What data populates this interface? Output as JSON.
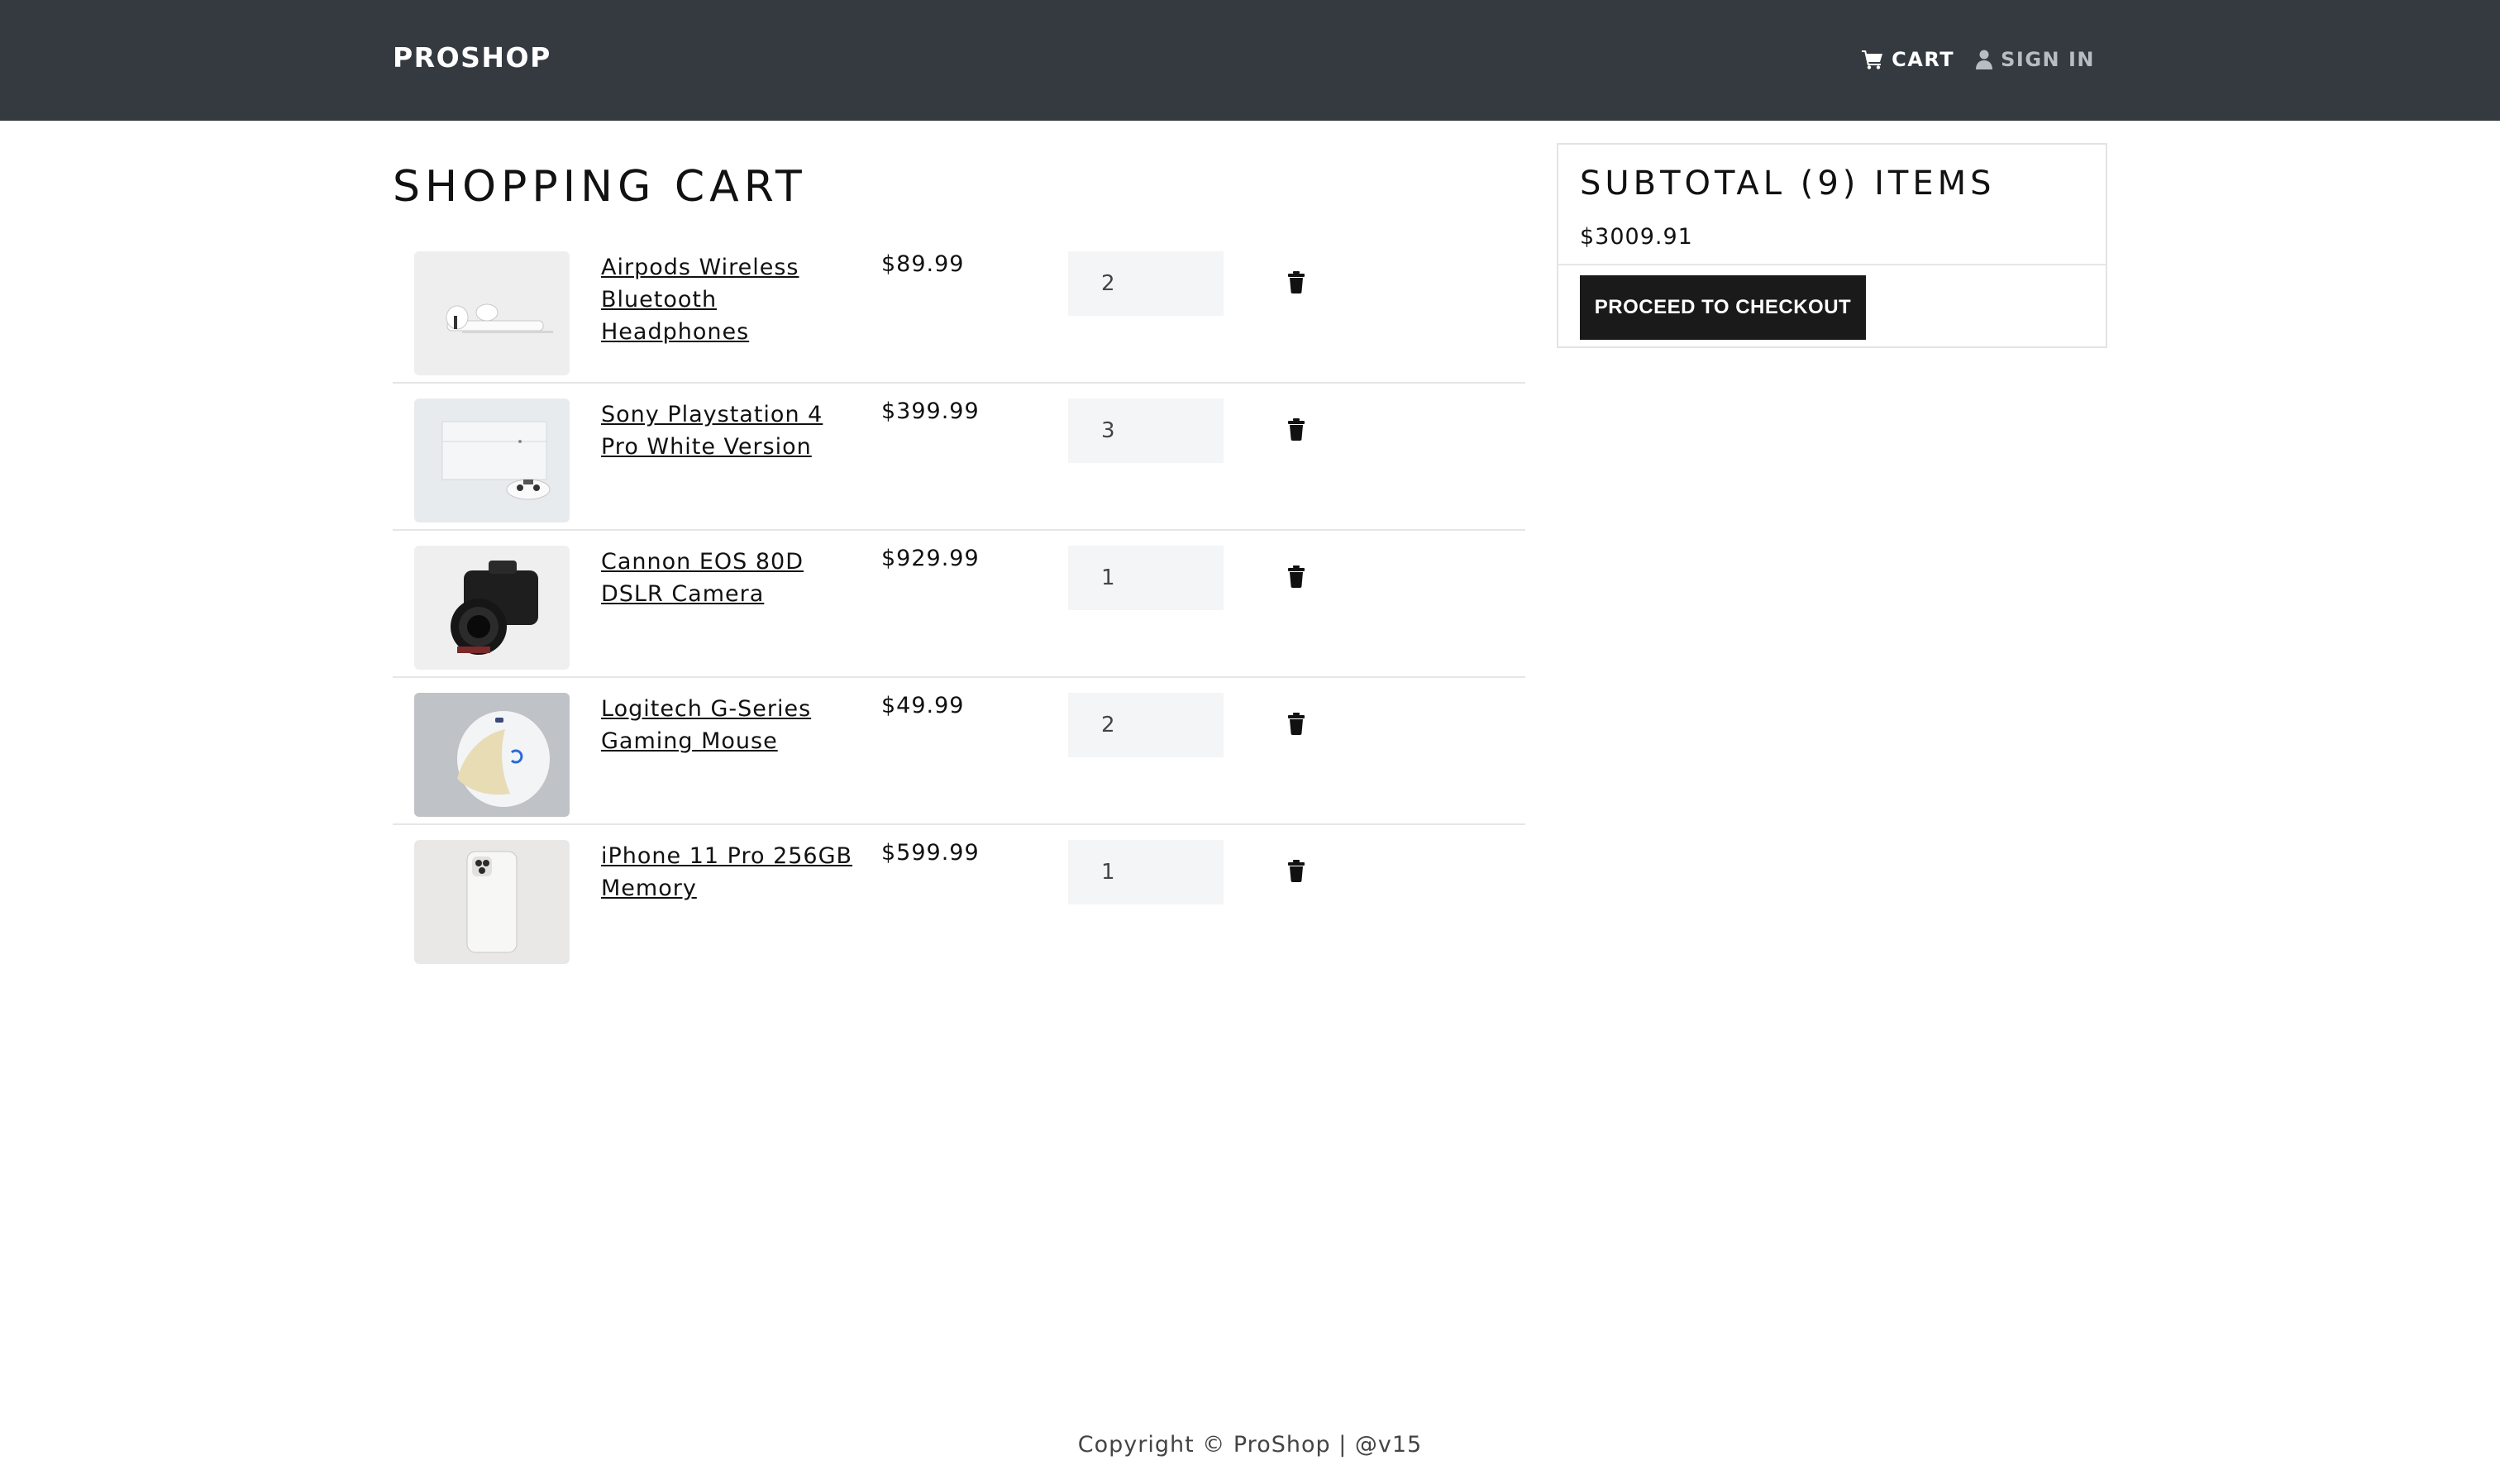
{
  "navbar": {
    "brand": "PROSHOP",
    "cart_label": "CART",
    "signin_label": "SIGN IN"
  },
  "page": {
    "title": "SHOPPING CART"
  },
  "cart": {
    "items": [
      {
        "name": "Airpods Wireless Bluetooth Headphones",
        "price": "$89.99",
        "qty": "2",
        "image": "airpods-image"
      },
      {
        "name": "Sony Playstation 4 Pro White Version",
        "price": "$399.99",
        "qty": "3",
        "image": "playstation-image"
      },
      {
        "name": "Cannon EOS 80D DSLR Camera",
        "price": "$929.99",
        "qty": "1",
        "image": "camera-image"
      },
      {
        "name": "Logitech G-Series Gaming Mouse",
        "price": "$49.99",
        "qty": "2",
        "image": "mouse-image"
      },
      {
        "name": "iPhone 11 Pro 256GB Memory",
        "price": "$599.99",
        "qty": "1",
        "image": "iphone-image"
      }
    ]
  },
  "summary": {
    "title": "SUBTOTAL (9) ITEMS",
    "total": "$3009.91",
    "checkout_label": "PROCEED TO CHECKOUT"
  },
  "footer": {
    "text": "Copyright © ProShop | @v15"
  },
  "colors": {
    "navbar": "#343a40",
    "button": "#1a1a1a",
    "qty_bg": "#f4f5f7"
  }
}
